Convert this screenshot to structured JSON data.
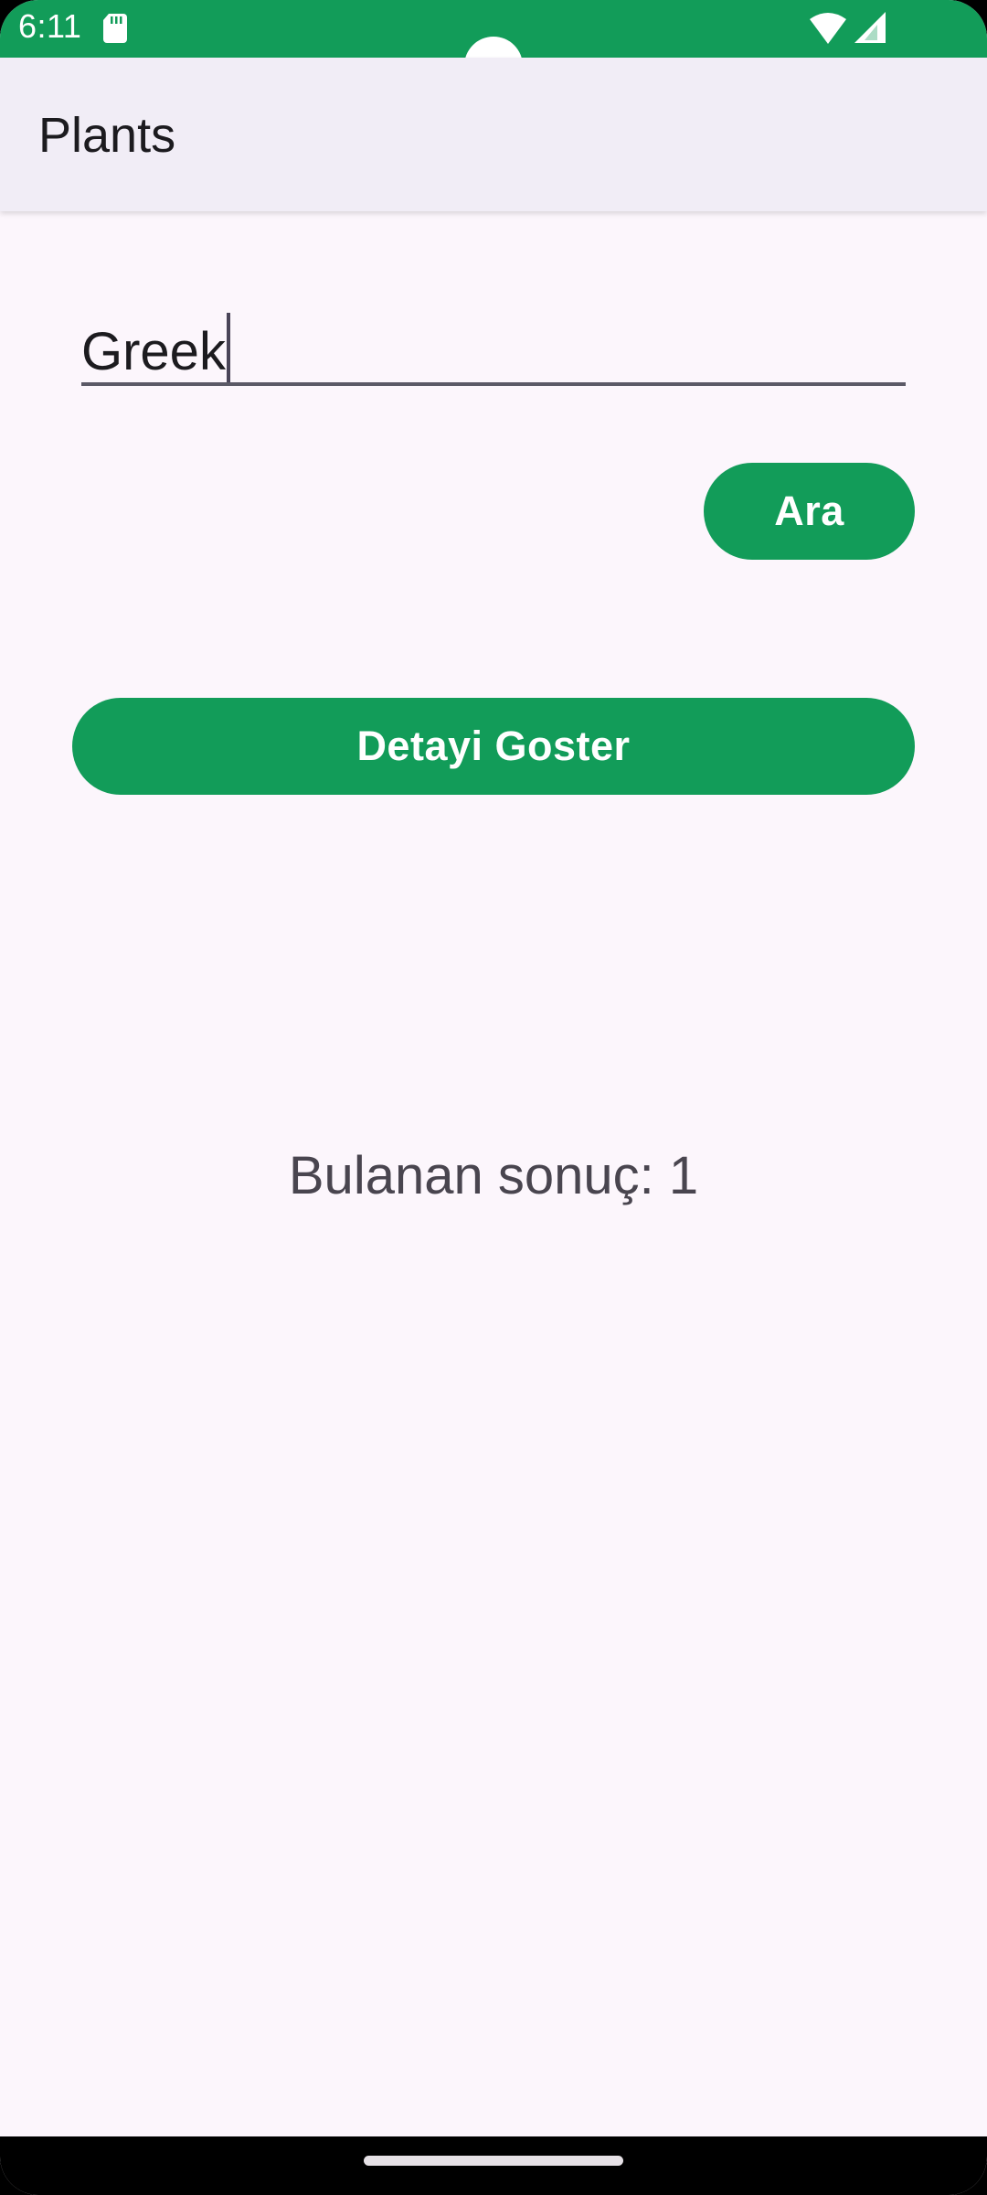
{
  "status_bar": {
    "time": "6:11",
    "background_color": "#129C59",
    "icons": [
      "sd-card-icon",
      "wifi-icon",
      "cell-signal-icon"
    ]
  },
  "app_bar": {
    "title": "Plants"
  },
  "search": {
    "value": "Greek",
    "cursor_visible": true
  },
  "buttons": {
    "search_label": "Ara",
    "detail_label": "Detayi Goster",
    "color": "#129C59"
  },
  "result": {
    "text": "Bulanan sonuç: 1"
  }
}
